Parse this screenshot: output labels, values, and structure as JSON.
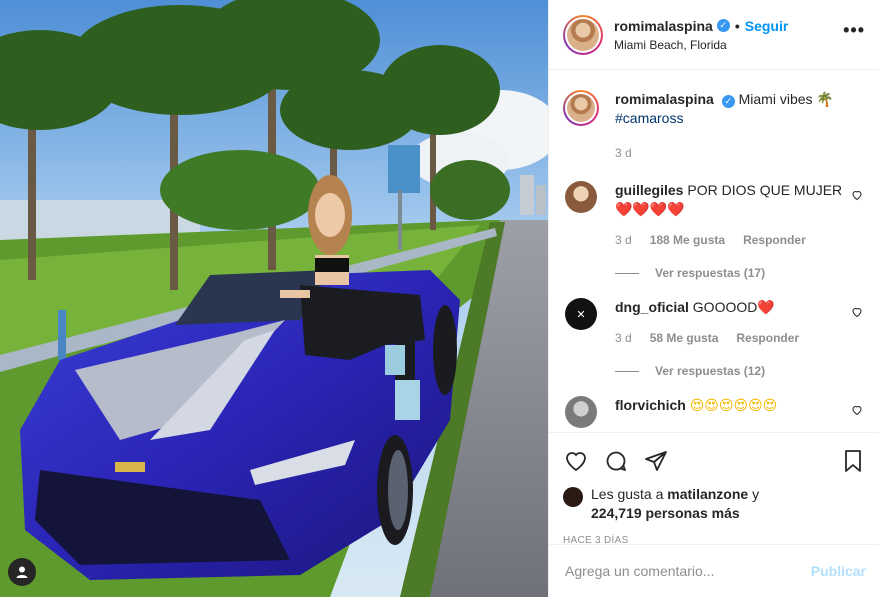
{
  "post": {
    "username": "romimalaspina",
    "location": "Miami Beach, Florida",
    "follow_label": "Seguir",
    "separator": "•",
    "more_label": "•••"
  },
  "caption": {
    "username": "romimalaspina",
    "text": "Miami vibes 🌴",
    "hashtag": "#camaross",
    "time": "3 d"
  },
  "comments": [
    {
      "username": "guillegiles",
      "text": "POR DIOS QUE MUJER",
      "emoji": "❤️❤️❤️❤️",
      "time": "3 d",
      "likes": "188 Me gusta",
      "reply_label": "Responder",
      "view_replies": "Ver respuestas (17)",
      "avatar_color": "#c49470"
    },
    {
      "username": "dng_oficial",
      "text": "GOOOOD",
      "emoji": "❤️",
      "time": "3 d",
      "likes": "58 Me gusta",
      "reply_label": "Responder",
      "view_replies": "Ver respuestas (12)",
      "avatar_color": "#111111"
    },
    {
      "username": "florvichich",
      "emoji": "😍😍😍😍😍😍",
      "avatar_color": "#8e8e8e"
    }
  ],
  "likes": {
    "prefix": "Les gusta a",
    "user": "matilanzone",
    "joiner": "y",
    "count": "224,719 personas más"
  },
  "time_ago": "HACE 3 DÍAS",
  "add_comment": {
    "placeholder": "Agrega un comentario...",
    "publish_label": "Publicar"
  },
  "icons": {
    "like": "heart-icon",
    "comment": "comment-icon",
    "share": "share-icon",
    "save": "bookmark-icon",
    "more": "more-options-icon",
    "verified": "verified-badge-icon",
    "user_tag": "user-tag-icon"
  },
  "colors": {
    "accent": "#0095f6",
    "verified": "#3897f0",
    "publish_disabled": "#b2dffc",
    "muted": "#8e8e8e"
  }
}
